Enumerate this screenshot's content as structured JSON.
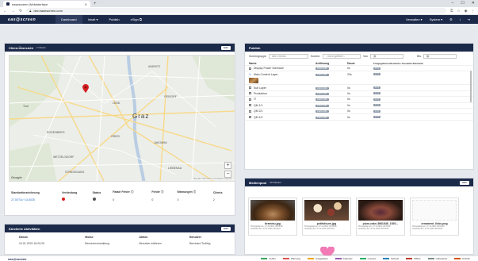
{
  "browser": {
    "tab_title": "easescreen Webinterface",
    "url": "dev.easescreen.com"
  },
  "nav": {
    "logo": "eas@screen",
    "items": [
      "Dashboard",
      "Inhalt ▾",
      "Publish",
      "eSign ⧉"
    ],
    "active": "Dashboard",
    "right": [
      "Verwalten ▾",
      "System ▾"
    ]
  },
  "client_panel": {
    "title": "Client-Übersicht",
    "subtitle": "2 Clients",
    "button": "mehr",
    "map": {
      "labels": [
        "Graz",
        "Thal",
        "EGGENBERG",
        "GRIES",
        "JAKOMINI",
        "GEIDORF",
        "LEND",
        "WETZELSDORF",
        "STRASSGANG",
        "ANDRITZ",
        "LIEBENAU"
      ],
      "attribution": "Map data ©2020   Terms of Use   Report a map error",
      "google": "Google"
    },
    "columns": [
      "Standortbezeichnung",
      "Verbindung",
      "Status",
      "Fatale Fehler ⓘ",
      "Fehler ⓘ",
      "Warnungen ⓘ",
      "Clients"
    ],
    "rows": [
      {
        "standort": "27-00T41~13-6025",
        "fatal": "0",
        "fehler": "0",
        "warn": "0",
        "clients": "2"
      }
    ]
  },
  "activity_panel": {
    "title": "Kürzliche Aktivitäten",
    "button": "mehr",
    "columns": [
      "Datum",
      "Modul",
      "Aktion",
      "Benutzer"
    ],
    "rows": [
      {
        "datum": "24.01.2020 15:03:29",
        "modul": "Benutzerverwaltung",
        "aktion": "Benutzer editieren",
        "benutzer": "Bernhard Todling"
      }
    ]
  },
  "publish_panel": {
    "title": "Publish",
    "filter": {
      "group_label": "Screengruppe",
      "group_value": "Alle Clients",
      "screen_label": "Screen:",
      "screen_value": "- nicht gefiltert -",
      "von_label": "Von",
      "bis_label": "Bis"
    },
    "columns": [
      "Name",
      "Auflösung",
      "Dauer",
      "Freigegebene Elemente / Gesamte Elemente"
    ],
    "rows": [
      {
        "name": "Display Power Schedule",
        "res": "1920×1080",
        "dur": "0s",
        "count": "0 / 0"
      },
      {
        "name": "Main Content Layer",
        "res": "1920×1080",
        "dur": "20s",
        "count": "2 / 2"
      },
      {
        "name": "Sub Layer",
        "res": "1920×1080",
        "dur": "0s",
        "count": "0 / 0"
      },
      {
        "name": "Produktion",
        "res": "1920×1080",
        "dur": "0s",
        "count": "0 / 0"
      },
      {
        "name": "IT",
        "res": "1920×1080",
        "dur": "0s",
        "count": "0 / 0"
      },
      {
        "name": "QM 1/1",
        "res": "1920×1080",
        "dur": "0s",
        "count": "0 / 0"
      },
      {
        "name": "QM 2/1",
        "res": "1920×1080",
        "dur": "0s",
        "count": "0 / 0"
      },
      {
        "name": "QM 1/2",
        "res": "1920×1080",
        "dur": "0s",
        "count": "0 / 0"
      }
    ]
  },
  "media_panel": {
    "title": "Medienpool",
    "subtitle": "60 Dateien",
    "button": "mehr",
    "items": [
      {
        "name": "tiramisu.jpg",
        "meta1": "Hinzugefügt am: 27.11.2019, 09:53:09",
        "meta2": "Verändert am: 27.11.2019, 09:23:07"
      },
      {
        "name": "petitsfours.jpg",
        "meta1": "Hinzugefügt am: 27.11.2019, 09:53:09",
        "meta2": "Verändert am: 27.11.2019, 09:23:07"
      },
      {
        "name": "plum-cake-3661848_1920...",
        "meta1": "Hinzugefügt am: 27.11.2019, 09:53:09",
        "meta2": "Verändert am: 27.11.2019, 09:53:09"
      },
      {
        "name": "ornament_links.png",
        "meta1": "Hinzugefügt am: 27.11.2019, 09:53:09",
        "meta2": "Verändert am: 27.11.2019, 09:53:09"
      }
    ]
  },
  "bottom": {
    "logo": "eas@screen",
    "legend": [
      "Fehler",
      "Warnung",
      "Ausgelastet",
      "Kalender",
      "Content",
      "Schnell",
      "Offline",
      "Unbekannt",
      "Kritisch"
    ],
    "legend_colors": [
      "#3aa55b",
      "#e05353",
      "#f0a500",
      "#9b59b6",
      "#27ae60",
      "#2980b9",
      "#c0392b",
      "#7f8c8d",
      "#d35400"
    ]
  },
  "colors": {
    "navy": "#1c2a4a",
    "red_dot": "#d62020"
  }
}
